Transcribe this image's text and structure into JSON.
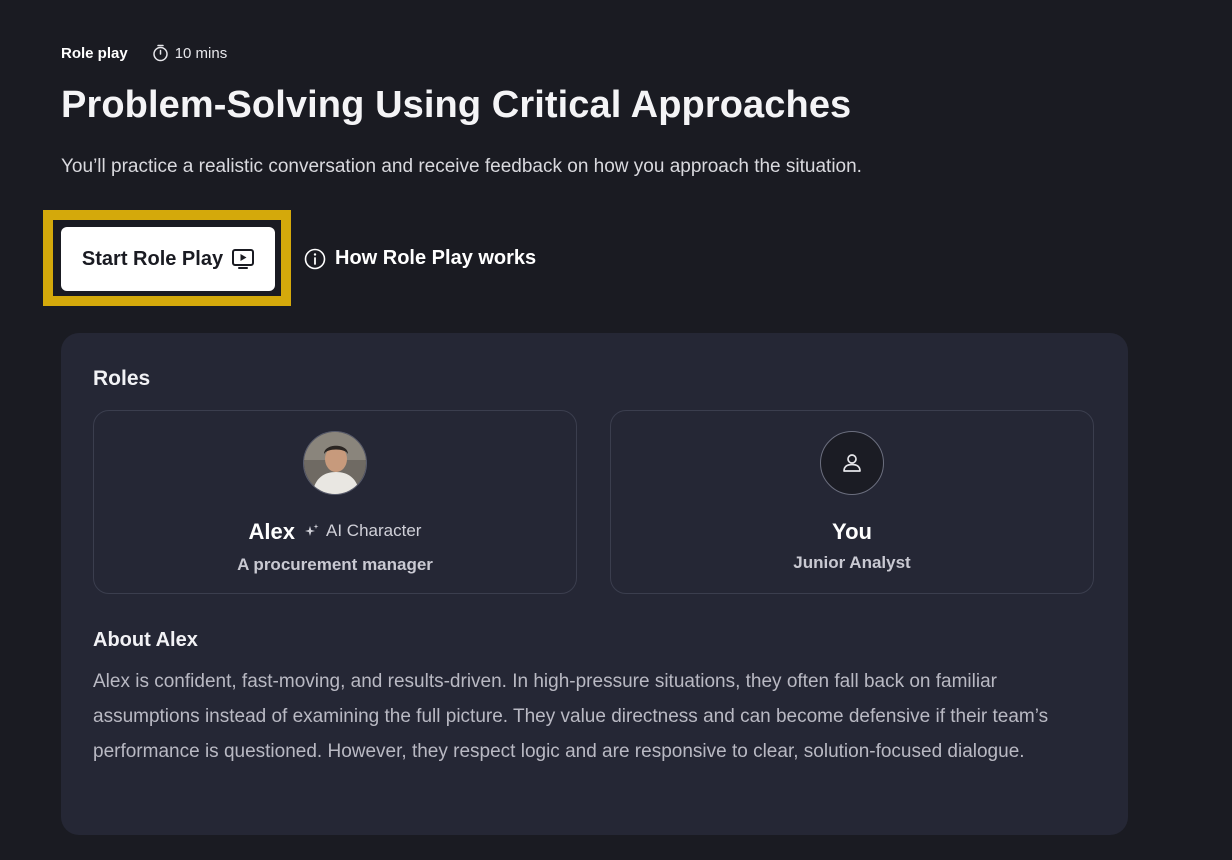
{
  "header": {
    "activity_type": "Role play",
    "duration": "10 mins",
    "title": "Problem-Solving Using Critical Approaches",
    "subtitle": "You’ll practice a realistic conversation and receive feedback on how you approach the situation."
  },
  "actions": {
    "start_label": "Start Role Play",
    "how_label": "How Role Play works"
  },
  "roles": {
    "heading": "Roles",
    "ai": {
      "name": "Alex",
      "tag": "AI Character",
      "description": "A procurement manager"
    },
    "user": {
      "name": "You",
      "description": "Junior Analyst"
    }
  },
  "about": {
    "heading": "About Alex",
    "body": "Alex is confident, fast-moving, and results-driven. In high-pressure situations, they often fall back on familiar assumptions instead of examining the full picture. They value directness and can become defensive if their team’s performance is questioned. However, they respect logic and are responsive to clear, solution-focused dialogue."
  },
  "colors": {
    "background": "#1a1b22",
    "card": "#252735",
    "highlight": "#d4a90b",
    "button": "#ffffff"
  },
  "icons": {
    "duration": "stopwatch-icon",
    "start": "play-screen-icon",
    "info": "info-circle-icon",
    "ai": "sparkle-icon",
    "user": "person-icon"
  }
}
